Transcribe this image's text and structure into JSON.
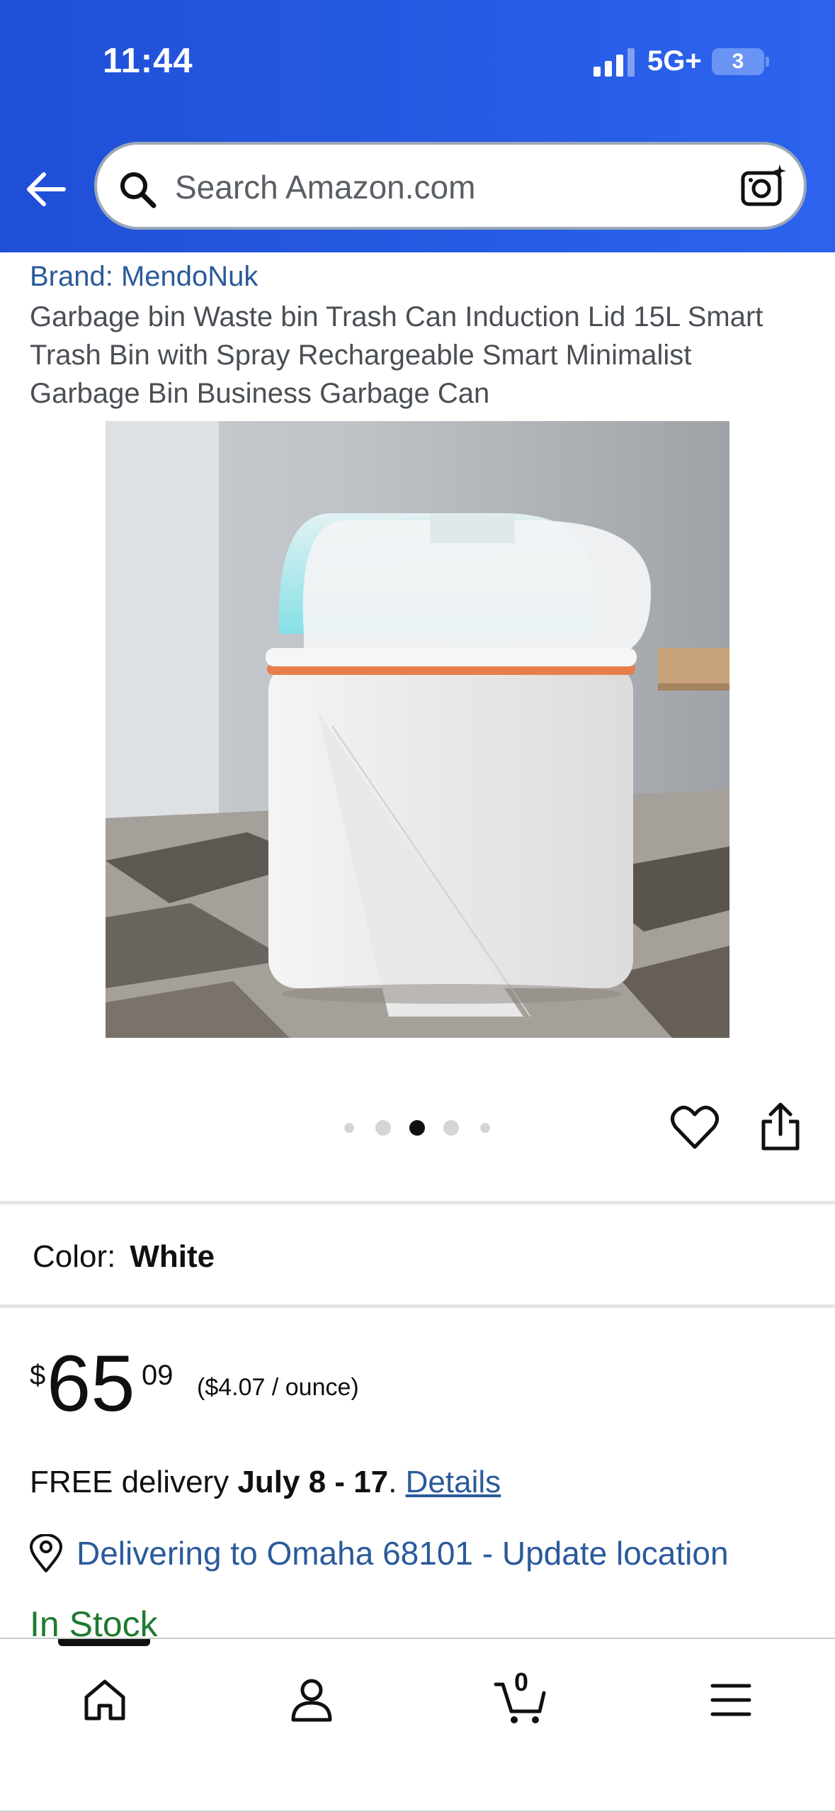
{
  "status_bar": {
    "time": "11:44",
    "network": "5G+",
    "battery": "3"
  },
  "header": {
    "search": {
      "placeholder": "Search Amazon.com",
      "value": ""
    },
    "icons": [
      "back-arrow-icon",
      "search-icon",
      "camera-icon"
    ],
    "colors": {
      "header_start": "#1f4fd6",
      "header_end": "#2c63ee"
    }
  },
  "product": {
    "brand": "Brand: MendoNuk",
    "title": "Garbage bin Waste bin Trash Can Induction Lid 15L Smart Trash Bin with Spray Rechargeable Smart Minimalist Garbage Bin Business Garbage Can",
    "image": {
      "selected_index": 2,
      "total_images": 5
    },
    "color_label": "Color:",
    "color_value": "White",
    "price": {
      "symbol": "$",
      "whole": "65",
      "fraction": "09",
      "unit_price": "($4.07 / ounce)"
    },
    "delivery": {
      "prefix": "FREE delivery ",
      "dates": "July 8 - 17",
      "suffix": ". ",
      "details_link": "Details"
    },
    "location": "Delivering to Omaha 68101 - Update location",
    "stock": "In Stock",
    "colors": {
      "link": "#2a5a9a",
      "in_stock": "#1e7a2f"
    }
  },
  "bottom_nav": {
    "items": [
      "home-icon",
      "account-icon",
      "cart-icon",
      "menu-icon"
    ],
    "active": "home",
    "cart_count": "0"
  }
}
